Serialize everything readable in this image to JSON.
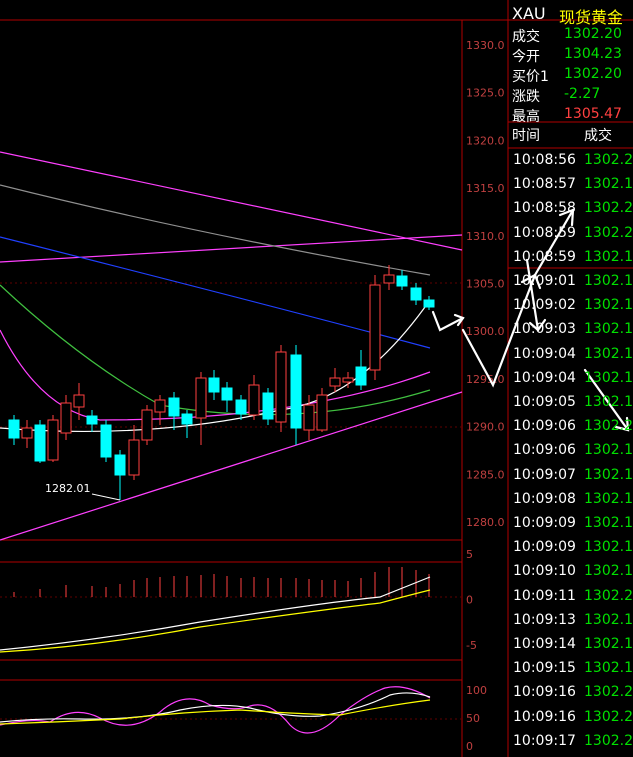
{
  "header": {
    "symbol": "XAU",
    "name": "现货黄金"
  },
  "quote": [
    {
      "label": "成交",
      "value": "1302.20",
      "color": "#00e000"
    },
    {
      "label": "今开",
      "value": "1304.23",
      "color": "#00e000"
    },
    {
      "label": "买价1",
      "value": "1302.20",
      "color": "#00e000"
    },
    {
      "label": "涨跌",
      "value": "-2.27",
      "color": "#00e000"
    },
    {
      "label": "最高",
      "value": "1305.47",
      "color": "#ff4040"
    }
  ],
  "ticks_header": {
    "time": "时间",
    "price": "成交"
  },
  "ticks": [
    {
      "time": "10:08:56",
      "price": "1302.2"
    },
    {
      "time": "10:08:57",
      "price": "1302.1"
    },
    {
      "time": "10:08:58",
      "price": "1302.2"
    },
    {
      "time": "10:08:59",
      "price": "1302.2"
    },
    {
      "time": "10:08:59",
      "price": "1302.1"
    },
    {
      "time": "10:09:01",
      "price": "1302.1"
    },
    {
      "time": "10:09:02",
      "price": "1302.1"
    },
    {
      "time": "10:09:03",
      "price": "1302.1"
    },
    {
      "time": "10:09:04",
      "price": "1302.1"
    },
    {
      "time": "10:09:04",
      "price": "1302.1"
    },
    {
      "time": "10:09:05",
      "price": "1302.1"
    },
    {
      "time": "10:09:06",
      "price": "1302.2"
    },
    {
      "time": "10:09:06",
      "price": "1302.1"
    },
    {
      "time": "10:09:07",
      "price": "1302.1"
    },
    {
      "time": "10:09:08",
      "price": "1302.1"
    },
    {
      "time": "10:09:09",
      "price": "1302.1"
    },
    {
      "time": "10:09:09",
      "price": "1302.1"
    },
    {
      "time": "10:09:10",
      "price": "1302.1"
    },
    {
      "time": "10:09:11",
      "price": "1302.2"
    },
    {
      "time": "10:09:13",
      "price": "1302.1"
    },
    {
      "time": "10:09:14",
      "price": "1302.1"
    },
    {
      "time": "10:09:15",
      "price": "1302.1"
    },
    {
      "time": "10:09:16",
      "price": "1302.2"
    },
    {
      "time": "10:09:16",
      "price": "1302.2"
    },
    {
      "time": "10:09:17",
      "price": "1302.2"
    }
  ],
  "price_axis": [
    "1330.0",
    "1325.0",
    "1320.0",
    "1315.0",
    "1310.0",
    "1305.0",
    "1300.0",
    "1295.0",
    "1290.0",
    "1285.0",
    "1280.0"
  ],
  "macd_axis": [
    "5",
    "0",
    "-5"
  ],
  "osc_axis": [
    "100",
    "50",
    "0"
  ],
  "low_label": "1282.01",
  "colors": {
    "up": "#ff4040",
    "down": "#00ffff",
    "frame": "#b00000",
    "text_axis": "#c04040"
  }
}
